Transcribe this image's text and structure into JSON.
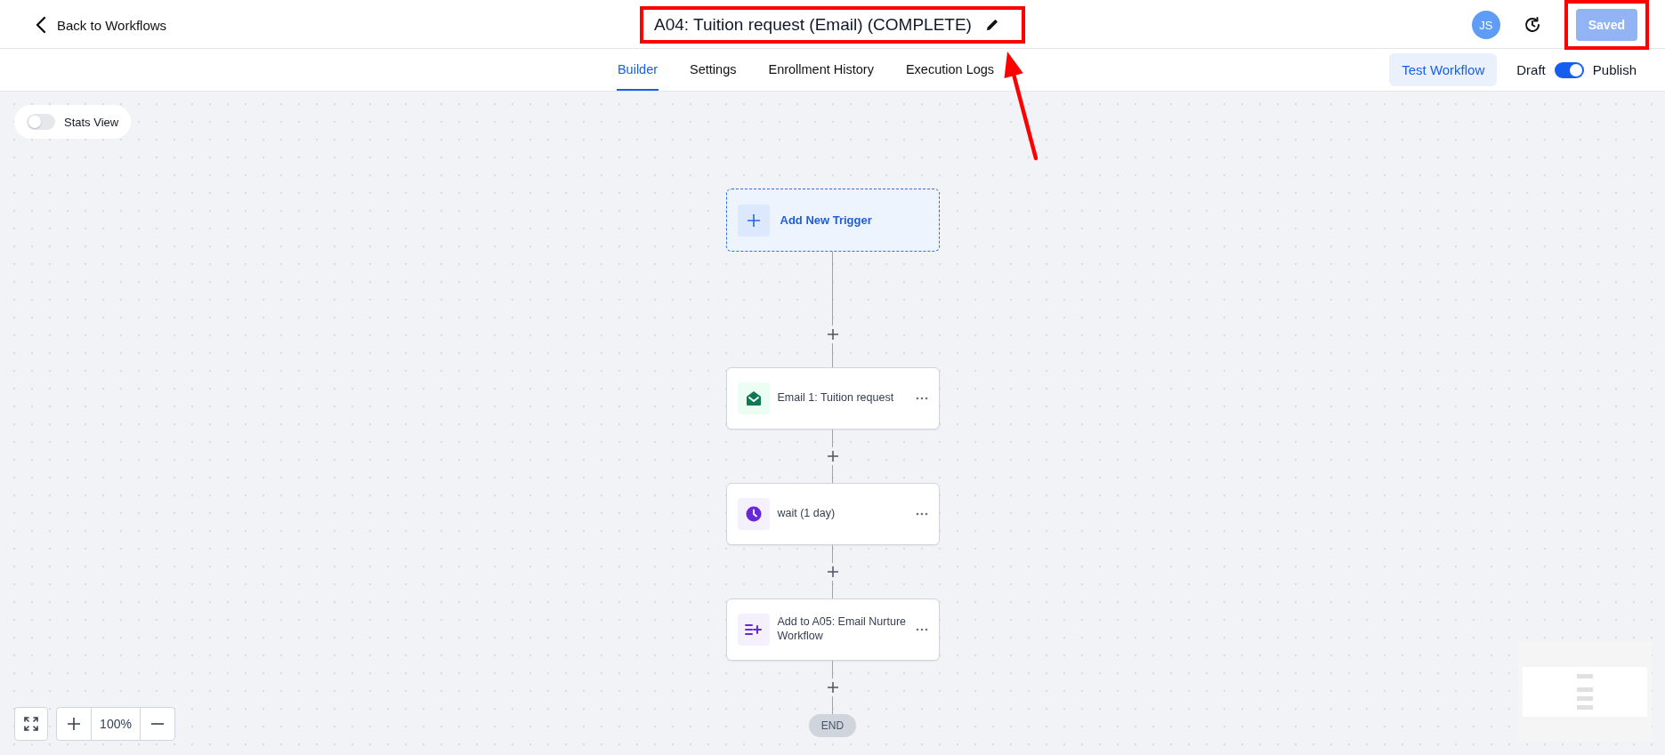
{
  "header": {
    "back_label": "Back to Workflows",
    "title": {
      "text": "A04: Tuition request (Email) (COMPLETE)",
      "highlighted": true,
      "arrow": true
    },
    "avatar_initials": "JS",
    "save_button": {
      "label": "Saved",
      "disabled": true,
      "highlighted": true
    }
  },
  "tabs": [
    {
      "label": "Builder",
      "selected": true
    },
    {
      "label": "Settings",
      "selected": false
    },
    {
      "label": "Enrollment History",
      "selected": false
    },
    {
      "label": "Execution Logs",
      "selected": false
    }
  ],
  "test_button": "Test Workflow",
  "publish_toggle": {
    "off_label": "Draft",
    "on_label": "Publish",
    "on": true
  },
  "stats_view": {
    "label": "Stats View",
    "on": false
  },
  "trigger": {
    "label": "Add New Trigger"
  },
  "steps": [
    {
      "kind": "email",
      "label": "Email 1: Tuition request"
    },
    {
      "kind": "wait",
      "label": "wait (1 day)"
    },
    {
      "kind": "workflow",
      "label": "Add to A05: Email Nurture Workflow"
    }
  ],
  "end_label": "END",
  "zoom": {
    "level": "100%"
  }
}
